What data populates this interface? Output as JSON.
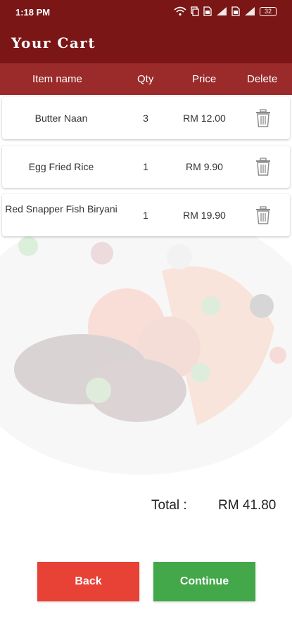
{
  "status_bar": {
    "time": "1:18 PM",
    "battery": "32",
    "icons": [
      "wifi-icon",
      "screen-mirror-icon",
      "sim-icon",
      "signal-icon",
      "sim-icon",
      "signal-icon",
      "battery-icon"
    ]
  },
  "app_bar": {
    "title": "Your Cart"
  },
  "table_header": {
    "item_name": "Item name",
    "qty": "Qty",
    "price": "Price",
    "delete": "Delete"
  },
  "cart_items": [
    {
      "name": "Butter Naan",
      "qty": "3",
      "price": "RM 12.00",
      "delete_icon": "trash-icon"
    },
    {
      "name": "Egg Fried Rice",
      "qty": "1",
      "price": "RM 9.90",
      "delete_icon": "trash-icon"
    },
    {
      "name": "Red Snapper Fish Biryani",
      "qty": "1",
      "price": "RM 19.90",
      "delete_icon": "trash-icon"
    }
  ],
  "total": {
    "label": "Total :",
    "value": "RM 41.80"
  },
  "buttons": {
    "back": "Back",
    "continue": "Continue"
  },
  "colors": {
    "app_bar": "#7a1616",
    "header_row": "#9b2a2a",
    "back_button": "#e84135",
    "continue_button": "#43a849"
  }
}
